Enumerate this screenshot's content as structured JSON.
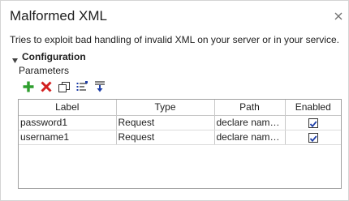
{
  "panel": {
    "title": "Malformed XML",
    "description": "Tries to exploit bad handling of invalid XML on your server or in your service."
  },
  "configuration": {
    "label": "Configuration",
    "expanded": true,
    "parameters_label": "Parameters",
    "toolbar": [
      "add-icon",
      "delete-icon",
      "clone-icon",
      "edit-list-icon",
      "sort-icon"
    ]
  },
  "table": {
    "columns": [
      "Label",
      "Type",
      "Path",
      "Enabled"
    ],
    "rows": [
      {
        "label": "password1",
        "type": "Request",
        "path": "declare names...",
        "enabled": true
      },
      {
        "label": "username1",
        "type": "Request",
        "path": "declare names...",
        "enabled": true
      }
    ]
  },
  "colors": {
    "add": "#2e9e2e",
    "delete": "#d32020",
    "sort_icon": "#1f3fa8"
  }
}
